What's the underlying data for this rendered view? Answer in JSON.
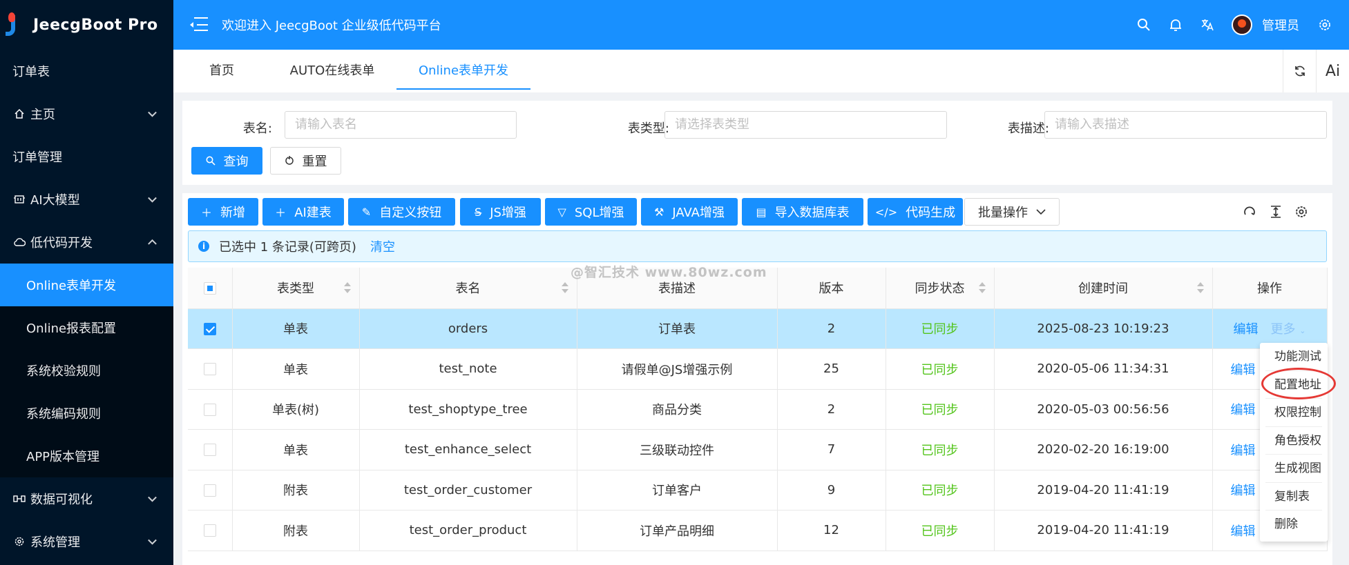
{
  "app": {
    "name": "JeecgBoot Pro"
  },
  "sidebar": {
    "items": [
      {
        "label": "订单表",
        "icon": ""
      },
      {
        "label": "主页",
        "icon": "home-icon",
        "chevron": "down"
      },
      {
        "label": "订单管理",
        "icon": ""
      },
      {
        "label": "AI大模型",
        "icon": "ai-model-icon",
        "chevron": "down"
      },
      {
        "label": "低代码开发",
        "icon": "cloud-icon",
        "chevron": "up"
      }
    ],
    "sub_items": [
      {
        "label": "Online表单开发",
        "active": true
      },
      {
        "label": "Online报表配置"
      },
      {
        "label": "系统校验规则"
      },
      {
        "label": "系统编码规则"
      },
      {
        "label": "APP版本管理"
      }
    ],
    "bottom_items": [
      {
        "label": "数据可视化",
        "icon": "chart-icon",
        "chevron": "down"
      },
      {
        "label": "系统管理",
        "icon": "gear-icon",
        "chevron": "down"
      }
    ]
  },
  "header": {
    "title": "欢迎进入 JeecgBoot 企业级低代码平台",
    "username": "管理员",
    "accent": "#1890ff"
  },
  "tabs": [
    {
      "label": "首页"
    },
    {
      "label": "AUTO在线表单"
    },
    {
      "label": "Online表单开发",
      "active": true
    }
  ],
  "tab_tools": {
    "refresh_icon": "refresh-icon",
    "ai_label": "Ai"
  },
  "search": {
    "fields": [
      {
        "label": "表名:",
        "placeholder": "请输入表名"
      },
      {
        "label": "表类型:",
        "placeholder": "请选择表类型"
      },
      {
        "label": "表描述:",
        "placeholder": "请输入表描述"
      }
    ],
    "query_label": "查询",
    "reset_label": "重置"
  },
  "toolbar": {
    "buttons": [
      {
        "label": "新增",
        "icon": "plus-icon"
      },
      {
        "label": "AI建表",
        "icon": "plus-icon"
      },
      {
        "label": "自定义按钮",
        "icon": "pen-icon"
      },
      {
        "label": "JS增强",
        "icon": "strike-icon"
      },
      {
        "label": "SQL增强",
        "icon": "filter-icon"
      },
      {
        "label": "JAVA增强",
        "icon": "wrench-icon"
      },
      {
        "label": "导入数据库表",
        "icon": "doc-icon"
      },
      {
        "label": "代码生成",
        "icon": "code-icon"
      }
    ],
    "batch_label": "批量操作"
  },
  "alert": {
    "text": "已选中 1 条记录(可跨页)",
    "clear_label": "清空"
  },
  "table": {
    "columns": [
      "表类型",
      "表名",
      "表描述",
      "版本",
      "同步状态",
      "创建时间",
      "操作"
    ],
    "rows": [
      {
        "type": "单表",
        "name": "orders",
        "desc": "订单表",
        "version": "2",
        "status": "已同步",
        "created": "2025-08-23 10:19:23",
        "selected": true
      },
      {
        "type": "单表",
        "name": "test_note",
        "desc": "请假单@JS增强示例",
        "version": "25",
        "status": "已同步",
        "created": "2020-05-06 11:34:31"
      },
      {
        "type": "单表(树)",
        "name": "test_shoptype_tree",
        "desc": "商品分类",
        "version": "2",
        "status": "已同步",
        "created": "2020-05-03 00:56:56"
      },
      {
        "type": "单表",
        "name": "test_enhance_select",
        "desc": "三级联动控件",
        "version": "7",
        "status": "已同步",
        "created": "2020-02-20 16:19:00"
      },
      {
        "type": "附表",
        "name": "test_order_customer",
        "desc": "订单客户",
        "version": "9",
        "status": "已同步",
        "created": "2019-04-20 11:41:19"
      },
      {
        "type": "附表",
        "name": "test_order_product",
        "desc": "订单产品明细",
        "version": "12",
        "status": "已同步",
        "created": "2019-04-20 11:41:19"
      }
    ],
    "edit_label": "编辑",
    "more_label": "更多"
  },
  "dropdown": {
    "items": [
      "功能测试",
      "配置地址",
      "权限控制",
      "角色授权",
      "生成视图",
      "复制表",
      "删除"
    ]
  },
  "watermark": "@智汇技术 www.80wz.com"
}
